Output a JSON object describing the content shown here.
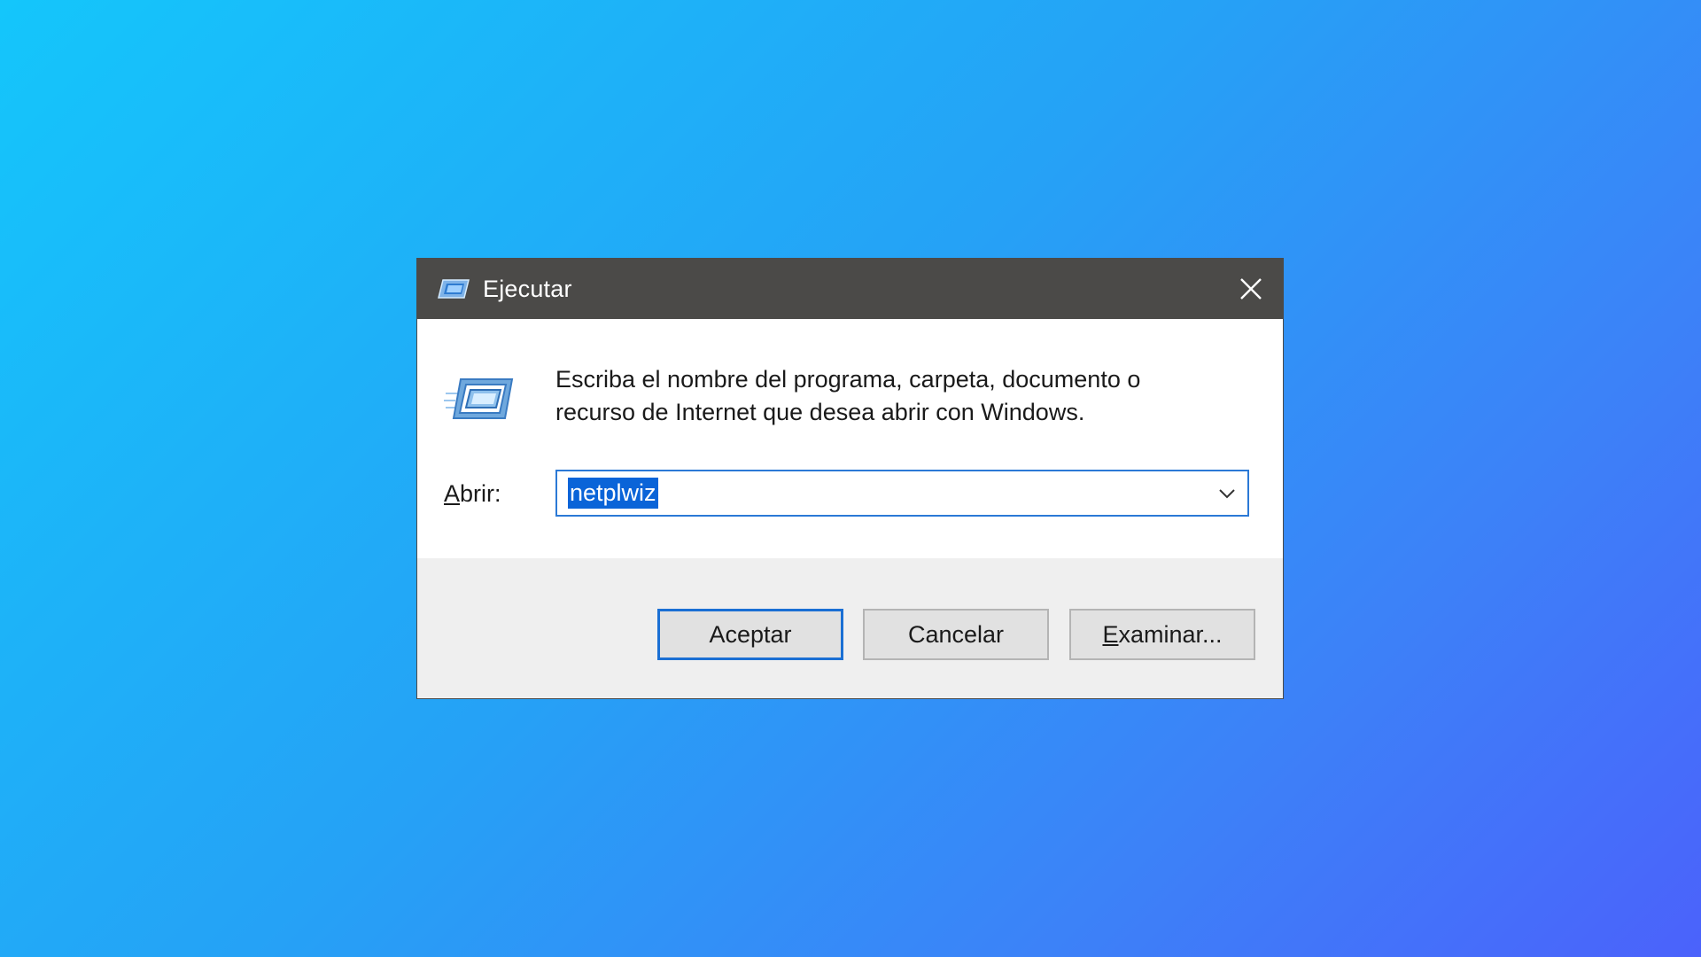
{
  "window": {
    "title": "Ejecutar",
    "close_icon": "close-icon",
    "app_icon": "run-icon"
  },
  "prompt": {
    "line1": "Escriba el nombre del programa, carpeta, documento o",
    "line2": "recurso de Internet que desea abrir con Windows."
  },
  "open_field": {
    "label_mnemonic": "A",
    "label_rest": "brir:",
    "value": "netplwiz",
    "dropdown_icon": "chevron-down-icon"
  },
  "buttons": {
    "ok": "Aceptar",
    "cancel": "Cancelar",
    "browse_mnemonic": "E",
    "browse_rest": "xaminar..."
  },
  "colors": {
    "titlebar": "#4b4a48",
    "selection": "#0a64d8",
    "focus_border": "#2b79d6"
  }
}
